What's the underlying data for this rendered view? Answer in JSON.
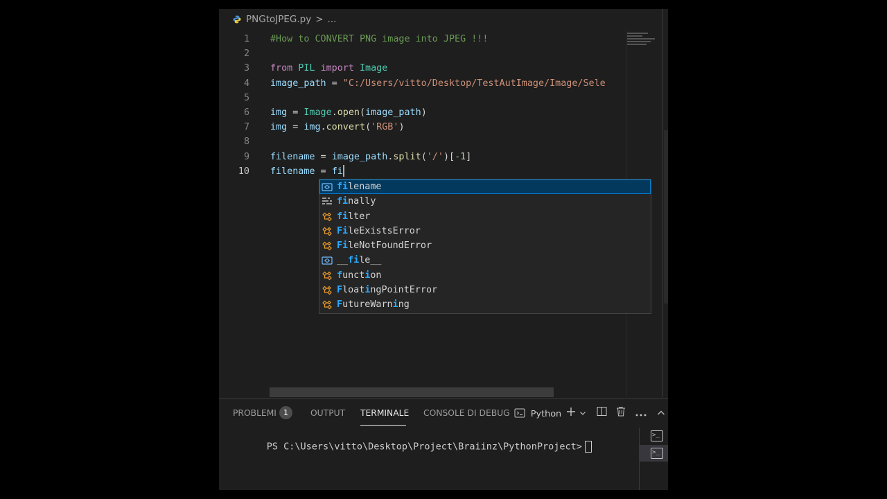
{
  "breadcrumb": {
    "file": "PNGtoJPEG.py",
    "separator": ">",
    "more": "..."
  },
  "editor": {
    "lines": [
      {
        "n": "1",
        "tokens": [
          {
            "t": "#How to CONVERT PNG image into JPEG !!!",
            "c": "cm"
          }
        ]
      },
      {
        "n": "2",
        "tokens": []
      },
      {
        "n": "3",
        "tokens": [
          {
            "t": "from",
            "c": "kw"
          },
          {
            "t": " PIL ",
            "c": "cls"
          },
          {
            "t": "import",
            "c": "kw"
          },
          {
            "t": " Image",
            "c": "cls"
          }
        ]
      },
      {
        "n": "4",
        "tokens": [
          {
            "t": "image_path",
            "c": "var"
          },
          {
            "t": " = ",
            "c": "op"
          },
          {
            "t": "\"C:/Users/vitto/Desktop/TestAutImage/Image/Sele",
            "c": "str"
          }
        ]
      },
      {
        "n": "5",
        "tokens": []
      },
      {
        "n": "6",
        "tokens": [
          {
            "t": "img",
            "c": "var"
          },
          {
            "t": " = ",
            "c": "op"
          },
          {
            "t": "Image",
            "c": "cls"
          },
          {
            "t": ".",
            "c": "op"
          },
          {
            "t": "open",
            "c": "fn"
          },
          {
            "t": "(",
            "c": "op"
          },
          {
            "t": "image_path",
            "c": "var"
          },
          {
            "t": ")",
            "c": "op"
          }
        ]
      },
      {
        "n": "7",
        "tokens": [
          {
            "t": "img",
            "c": "var"
          },
          {
            "t": " = ",
            "c": "op"
          },
          {
            "t": "img",
            "c": "var"
          },
          {
            "t": ".",
            "c": "op"
          },
          {
            "t": "convert",
            "c": "fn"
          },
          {
            "t": "(",
            "c": "op"
          },
          {
            "t": "'RGB'",
            "c": "str"
          },
          {
            "t": ")",
            "c": "op"
          }
        ]
      },
      {
        "n": "8",
        "tokens": []
      },
      {
        "n": "9",
        "tokens": [
          {
            "t": "filename",
            "c": "var"
          },
          {
            "t": " = ",
            "c": "op"
          },
          {
            "t": "image_path",
            "c": "var"
          },
          {
            "t": ".",
            "c": "op"
          },
          {
            "t": "split",
            "c": "fn"
          },
          {
            "t": "(",
            "c": "op"
          },
          {
            "t": "'/'",
            "c": "str"
          },
          {
            "t": ")[",
            "c": "op"
          },
          {
            "t": "-1",
            "c": "num"
          },
          {
            "t": "]",
            "c": "op"
          }
        ]
      },
      {
        "n": "10",
        "current": true,
        "tokens": [
          {
            "t": "filename",
            "c": "var"
          },
          {
            "t": " = ",
            "c": "op"
          },
          {
            "t": "fi",
            "c": "var"
          }
        ],
        "caret": true
      }
    ]
  },
  "suggestions": [
    {
      "parts": [
        {
          "t": "fi",
          "hl": true
        },
        {
          "t": "lename"
        }
      ],
      "icon": "variable-icon",
      "selected": true
    },
    {
      "parts": [
        {
          "t": "fi",
          "hl": true
        },
        {
          "t": "nally"
        }
      ],
      "icon": "keyword-icon"
    },
    {
      "parts": [
        {
          "t": "fi",
          "hl": true
        },
        {
          "t": "lter"
        }
      ],
      "icon": "class-icon"
    },
    {
      "parts": [
        {
          "t": "Fi",
          "hl": true
        },
        {
          "t": "leExistsError"
        }
      ],
      "icon": "class-icon"
    },
    {
      "parts": [
        {
          "t": "Fi",
          "hl": true
        },
        {
          "t": "leNotFoundError"
        }
      ],
      "icon": "class-icon"
    },
    {
      "parts": [
        {
          "t": "__"
        },
        {
          "t": "fi",
          "hl": true
        },
        {
          "t": "le__"
        }
      ],
      "icon": "variable-icon"
    },
    {
      "parts": [
        {
          "t": "f",
          "hl": true
        },
        {
          "t": "unct"
        },
        {
          "t": "i",
          "hl": true
        },
        {
          "t": "on"
        }
      ],
      "icon": "class-icon"
    },
    {
      "parts": [
        {
          "t": "F",
          "hl": true
        },
        {
          "t": "loat"
        },
        {
          "t": "i",
          "hl": true
        },
        {
          "t": "ngPointError"
        }
      ],
      "icon": "class-icon"
    },
    {
      "parts": [
        {
          "t": "F",
          "hl": true
        },
        {
          "t": "utureWarn"
        },
        {
          "t": "i",
          "hl": true
        },
        {
          "t": "ng"
        }
      ],
      "icon": "class-icon"
    }
  ],
  "panel": {
    "tabs": {
      "problems": "PROBLEMI",
      "problems_count": "1",
      "output": "OUTPUT",
      "terminal": "TERMINALE",
      "debug": "CONSOLE DI DEBUG"
    },
    "terminal_profile": "Python",
    "prompt": "PS C:\\Users\\vitto\\Desktop\\Project\\Braiinz\\PythonProject>"
  },
  "colors": {
    "editor_bg": "#1e1e1e",
    "selection": "#04395e",
    "highlight": "#2aaaff"
  }
}
